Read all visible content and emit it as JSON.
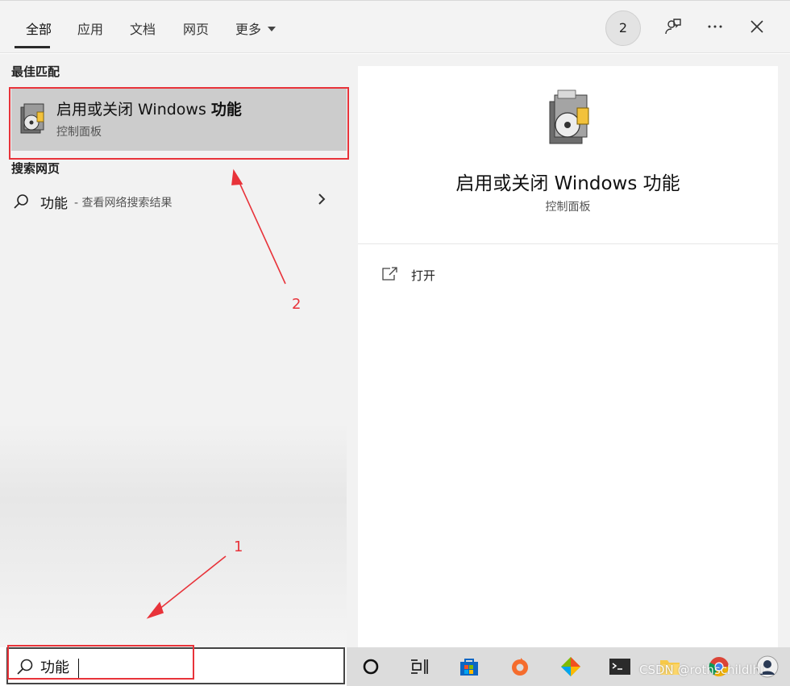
{
  "tabs": [
    {
      "label": "全部",
      "active": true
    },
    {
      "label": "应用"
    },
    {
      "label": "文档"
    },
    {
      "label": "网页"
    },
    {
      "label": "更多"
    }
  ],
  "header": {
    "badge_count": "2",
    "feedback_icon": "feedback-icon",
    "more_icon": "ellipsis-icon",
    "close_icon": "close-icon"
  },
  "left": {
    "best_match_title": "最佳匹配",
    "best_match": {
      "title_prefix": "启用或关闭 Windows ",
      "title_bold": "功能",
      "subtitle": "控制面板",
      "icon": "windows-features-icon"
    },
    "web_section_title": "搜索网页",
    "web_result": {
      "query": "功能",
      "hint": "- 查看网络搜索结果",
      "icon": "search-icon"
    }
  },
  "detail": {
    "title": "启用或关闭 Windows 功能",
    "subtitle": "控制面板",
    "actions": [
      {
        "label": "打开",
        "icon": "open-external-icon"
      }
    ]
  },
  "search": {
    "value": "功能",
    "icon": "search-icon"
  },
  "taskbar": {
    "icons": [
      "cortana-circle-icon",
      "task-view-icon",
      "microsoft-store-icon",
      "origin-icon",
      "gem-app-icon",
      "terminal-icon",
      "file-explorer-icon",
      "chrome-icon",
      "avatar-icon"
    ]
  },
  "watermark": "CSDN @rothschildlhl",
  "annotations": {
    "label_1": "1",
    "label_2": "2",
    "color": "#e8333a"
  }
}
